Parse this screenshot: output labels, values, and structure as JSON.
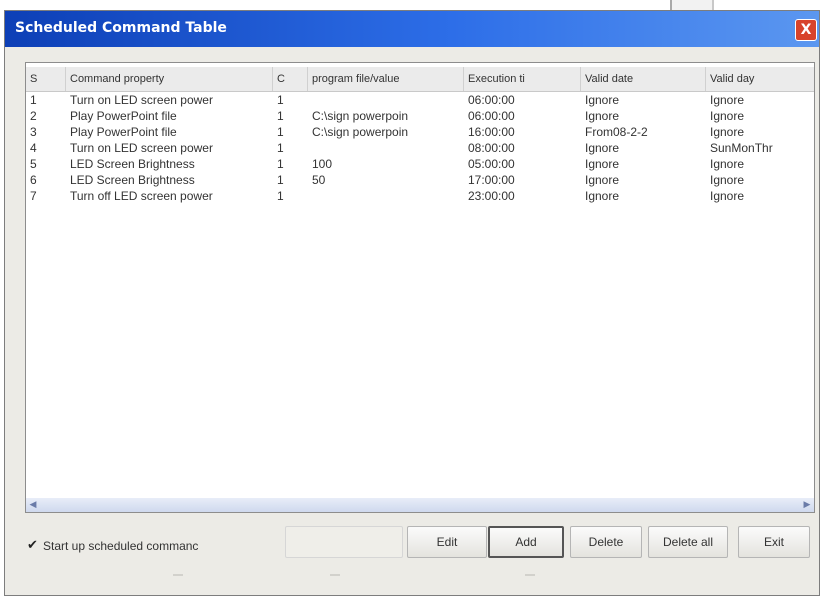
{
  "window": {
    "title": "Scheduled Command Table",
    "close_glyph": "X",
    "accent_color": "#1f59d6"
  },
  "table": {
    "columns": [
      "S",
      "Command property",
      "C",
      "program file/value",
      "Execution ti",
      "Valid date",
      "Valid day"
    ],
    "rows": [
      [
        "1",
        "Turn on LED screen power",
        "1",
        "",
        "06:00:00",
        "Ignore",
        "Ignore"
      ],
      [
        "2",
        "Play PowerPoint file",
        "1",
        "C:\\sign powerpoin",
        "06:00:00",
        "Ignore",
        "Ignore"
      ],
      [
        "3",
        "Play PowerPoint file",
        "1",
        "C:\\sign powerpoin",
        "16:00:00",
        "From08-2-2",
        "Ignore"
      ],
      [
        "4",
        "Turn on LED screen power",
        "1",
        "",
        "08:00:00",
        "Ignore",
        "SunMonThr"
      ],
      [
        "5",
        "LED Screen Brightness",
        "1",
        "100",
        "05:00:00",
        "Ignore",
        "Ignore"
      ],
      [
        "6",
        "LED Screen Brightness",
        "1",
        "50",
        "17:00:00",
        "Ignore",
        "Ignore"
      ],
      [
        "7",
        "Turn off LED screen power",
        "1",
        "",
        "23:00:00",
        "Ignore",
        "Ignore"
      ]
    ]
  },
  "footer": {
    "startup_label": "Start up scheduled commanc",
    "startup_checked": true,
    "buttons": {
      "edit": "Edit",
      "add": "Add",
      "delete": "Delete",
      "delete_all": "Delete all",
      "exit": "Exit"
    }
  },
  "icons": {
    "scroll_left": "scroll-left-arrow-icon",
    "scroll_right": "scroll-right-arrow-icon",
    "checkmark": "checkmark-icon",
    "close": "close-icon"
  }
}
